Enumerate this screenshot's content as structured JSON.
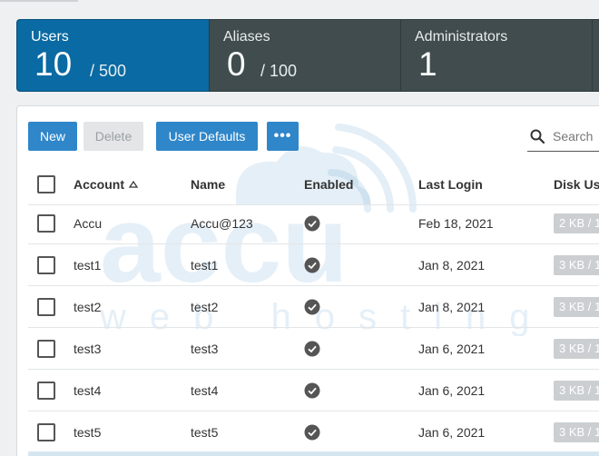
{
  "stats": {
    "users": {
      "label": "Users",
      "count": "10",
      "limit": "/ 500"
    },
    "aliases": {
      "label": "Aliases",
      "count": "0",
      "limit": "/ 100"
    },
    "administrators": {
      "label": "Administrators",
      "count": "1"
    }
  },
  "toolbar": {
    "new_label": "New",
    "delete_label": "Delete",
    "user_defaults_label": "User Defaults",
    "more_label": "•••",
    "search_placeholder": "Search"
  },
  "table": {
    "headers": {
      "account": "Account",
      "name": "Name",
      "enabled": "Enabled",
      "last_login": "Last Login",
      "disk_usage": "Disk Usa"
    },
    "rows": [
      {
        "account": "Accu",
        "name": "Accu@123",
        "last_login": "Feb 18, 2021",
        "disk": "2 KB / 1"
      },
      {
        "account": "test1",
        "name": "test1",
        "last_login": "Jan 8, 2021",
        "disk": "3 KB / 1"
      },
      {
        "account": "test2",
        "name": "test2",
        "last_login": "Jan 8, 2021",
        "disk": "3 KB / 1"
      },
      {
        "account": "test3",
        "name": "test3",
        "last_login": "Jan 6, 2021",
        "disk": "3 KB / 1"
      },
      {
        "account": "test4",
        "name": "test4",
        "last_login": "Jan 6, 2021",
        "disk": "3 KB / 1"
      },
      {
        "account": "test5",
        "name": "test5",
        "last_login": "Jan 6, 2021",
        "disk": "3 KB / 1"
      }
    ]
  },
  "watermark": {
    "brand": "accu",
    "tagline": "web hosting"
  },
  "colors": {
    "accent": "#0a6aa3",
    "tile_dark": "#404c4e",
    "button": "#2f86c9"
  }
}
